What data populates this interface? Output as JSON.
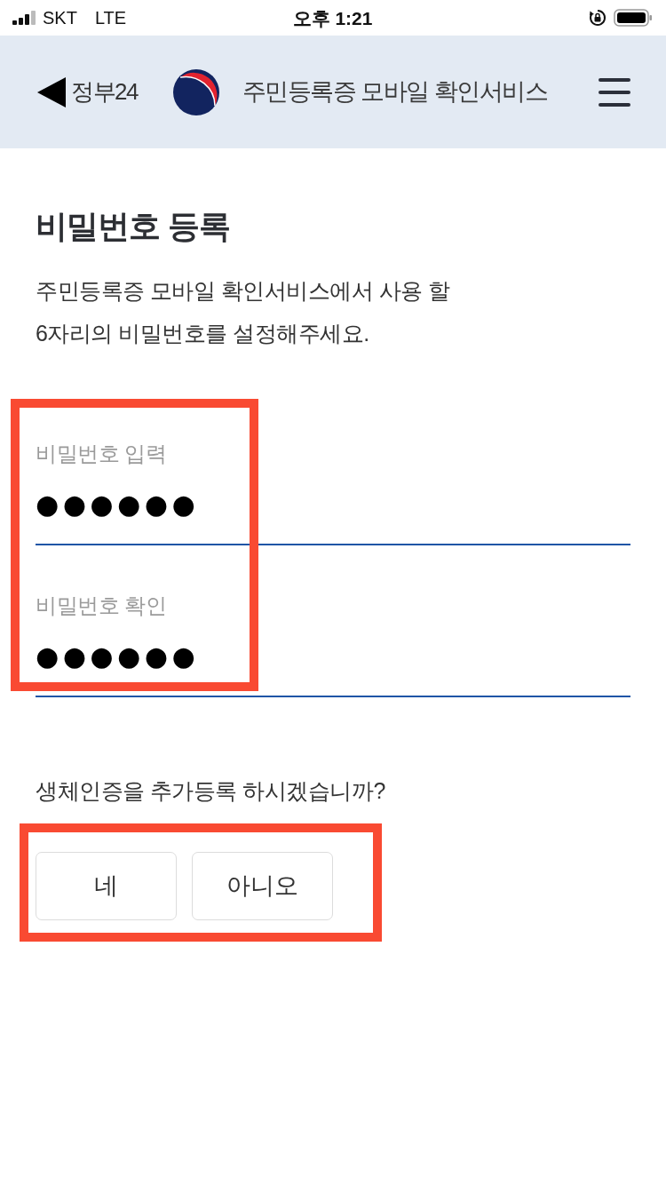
{
  "status_bar": {
    "carrier": "SKT",
    "network": "LTE",
    "time": "오후 1:21"
  },
  "header": {
    "back_label": "정부24",
    "title": "주민등록증 모바일 확인서비스"
  },
  "page": {
    "heading": "비밀번호 등록",
    "description": "주민등록증 모바일 확인서비스에서 사용 할\n6자리의 비밀번호를 설정해주세요."
  },
  "password_form": {
    "highlighted": true,
    "fields": [
      {
        "label": "비밀번호 입력",
        "value": "●●●●●●"
      },
      {
        "label": "비밀번호 확인",
        "value": "●●●●●●"
      }
    ]
  },
  "biometric": {
    "question": "생체인증을 추가등록 하시겠습니까?",
    "highlighted": true,
    "buttons": [
      "네",
      "아니오"
    ]
  }
}
